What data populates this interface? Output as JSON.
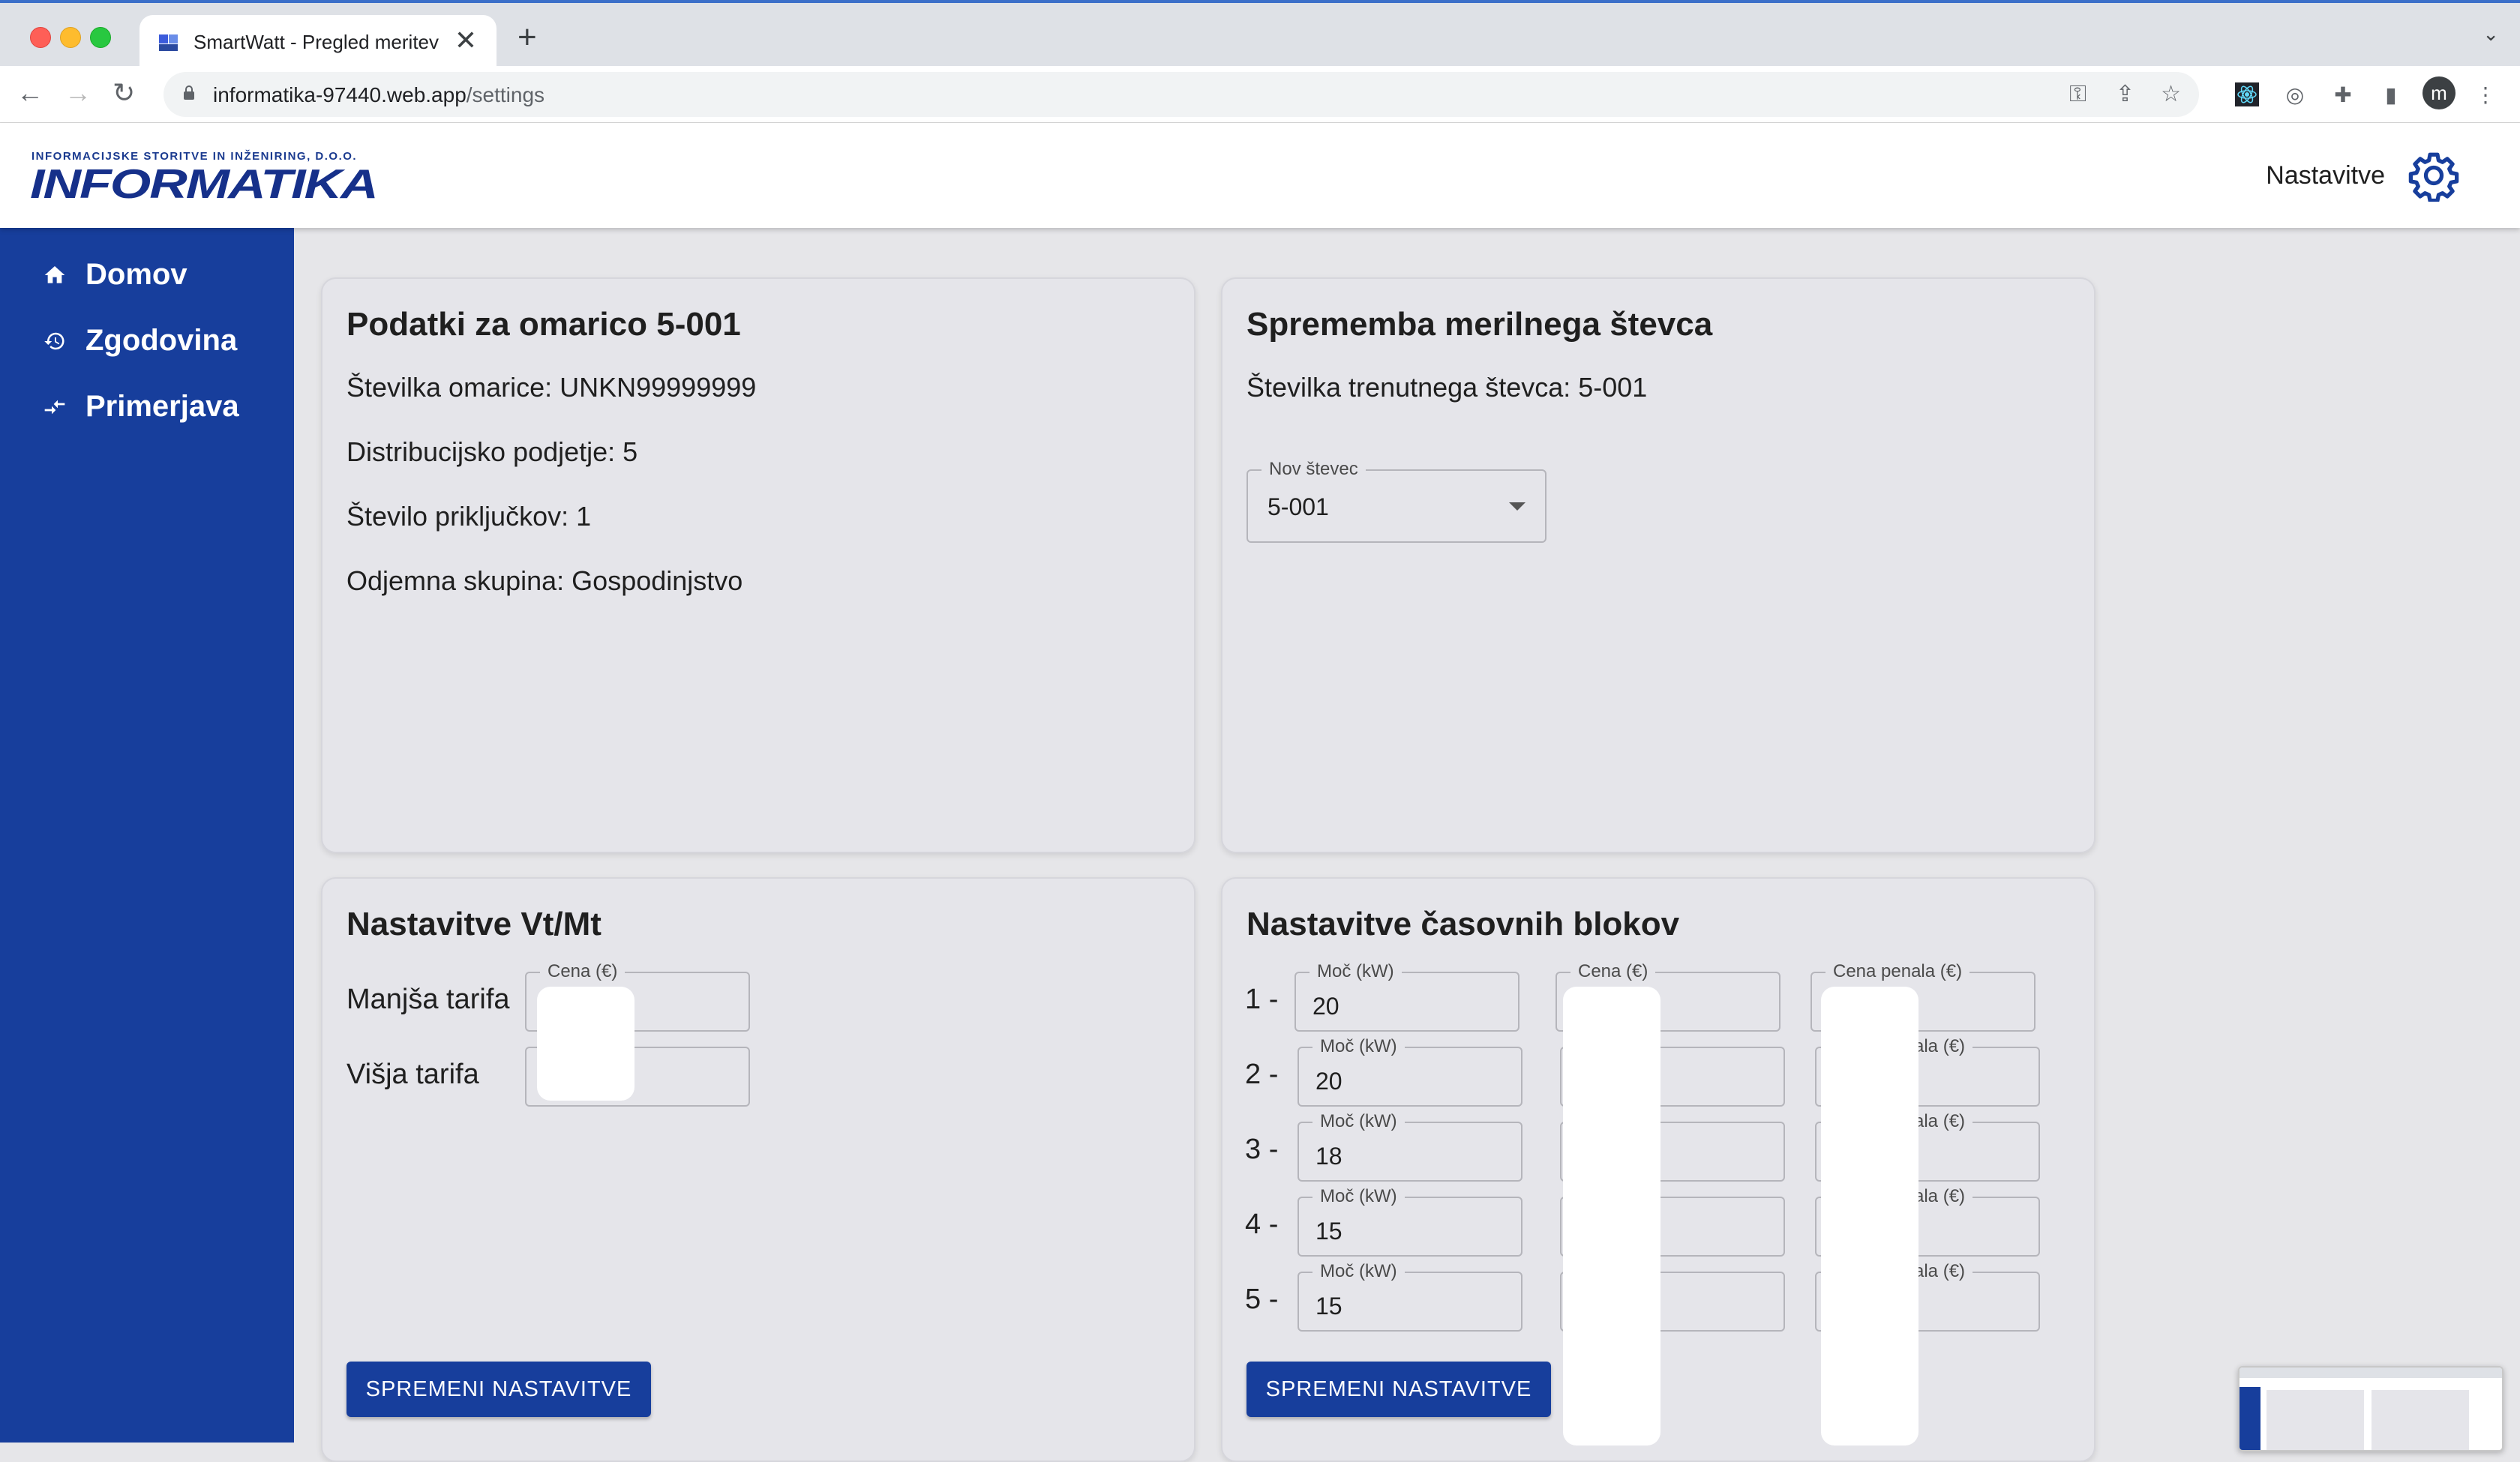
{
  "browser": {
    "tab_title": "SmartWatt - Pregled meritev",
    "tab_close": "✕",
    "new_tab": "+",
    "tab_menu": "⌄",
    "url_host": "informatika-97440.web.app",
    "url_path": "/settings",
    "profile_initial": "m"
  },
  "header": {
    "logo_subtitle": "INFORMACIJSKE STORITVE IN INŽENIRING, D.O.O.",
    "logo_text": "INFORMATIKA",
    "settings_label": "Nastavitve"
  },
  "sidebar": {
    "items": [
      {
        "label": "Domov",
        "icon": "home-icon"
      },
      {
        "label": "Zgodovina",
        "icon": "history-icon"
      },
      {
        "label": "Primerjava",
        "icon": "compare-icon"
      }
    ]
  },
  "info_card": {
    "title": "Podatki za omarico 5-001",
    "lines": [
      "Številka omarice: UNKN99999999",
      "Distribucijsko podjetje: 5",
      "Število priključkov: 1",
      "Odjemna skupina: Gospodinjstvo"
    ]
  },
  "meter_card": {
    "title": "Sprememba merilnega števca",
    "current_meter": "Številka trenutnega števca: 5-001",
    "select_label": "Nov števec",
    "select_value": "5-001"
  },
  "tariff_card": {
    "title": "Nastavitve Vt/Mt",
    "price_label": "Cena (€)",
    "rows": [
      "Manjša tarifa",
      "Višja tarifa"
    ],
    "button": "SPREMENI NASTAVITVE"
  },
  "blocks_card": {
    "title": "Nastavitve časovnih blokov",
    "power_label": "Moč (kW)",
    "price_label": "Cena (€)",
    "penalty_label": "Cena penala (€)",
    "penalty_label_partial": "ala (€)",
    "rows": [
      {
        "label": "1 -",
        "power": "20"
      },
      {
        "label": "2 -",
        "power": "20"
      },
      {
        "label": "3 -",
        "power": "18"
      },
      {
        "label": "4 -",
        "power": "15"
      },
      {
        "label": "5 -",
        "power": "15"
      }
    ],
    "button": "SPREMENI NASTAVITVE"
  },
  "colors": {
    "brand_blue": "#173e9c",
    "card_bg": "#e5e5ea",
    "page_bg": "#e6e6e9"
  }
}
